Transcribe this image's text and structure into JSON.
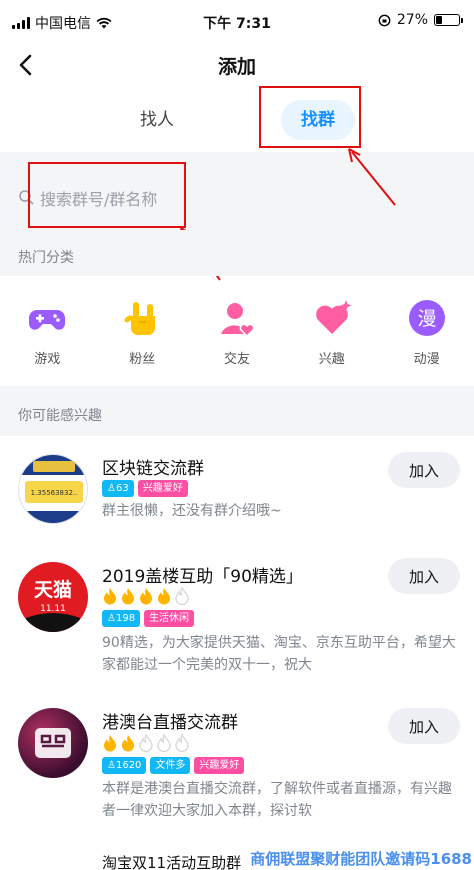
{
  "status_bar": {
    "carrier": "中国电信",
    "time": "下午 7:31",
    "battery_percent": "27%",
    "battery_level": 0.27
  },
  "nav": {
    "title": "添加"
  },
  "tabs": [
    {
      "label": "找人",
      "selected": false
    },
    {
      "label": "找群",
      "selected": true
    }
  ],
  "search": {
    "placeholder": "搜索群号/群名称"
  },
  "hot_categories": {
    "title": "热门分类",
    "items": [
      {
        "label": "游戏",
        "icon": "gamepad-icon"
      },
      {
        "label": "粉丝",
        "icon": "rock-hand-icon"
      },
      {
        "label": "交友",
        "icon": "friend-icon"
      },
      {
        "label": "兴趣",
        "icon": "heart-icon"
      },
      {
        "label": "动漫",
        "icon": "manga-icon",
        "glyph": "漫"
      }
    ]
  },
  "recommend": {
    "title": "你可能感兴趣",
    "groups": [
      {
        "name": "区块链交流群",
        "member_count": "63",
        "tags": [
          "兴趣爱好"
        ],
        "description": "群主很懒，还没有群介绍哦~",
        "join_label": "加入",
        "avatar_text": "1.35563832..",
        "fire_level": 0
      },
      {
        "name": "2019盖楼互助「90精选」",
        "member_count": "198",
        "tags": [
          "生活休闲"
        ],
        "description": "90精选，为大家提供天猫、淘宝、京东互助平台，希望大家都能过一个完美的双十一，祝大",
        "join_label": "加入",
        "avatar_text": "天猫",
        "avatar_sub": "11.11",
        "fire_level": 4
      },
      {
        "name": "港澳台直播交流群",
        "member_count": "1620",
        "tags": [
          "文件多",
          "兴趣爱好"
        ],
        "description": "本群是港澳台直播交流群，了解软件或者直播源，有兴趣者一律欢迎大家加入本群，探讨软",
        "join_label": "加入",
        "fire_level": 2
      }
    ],
    "partial_next": "淘宝双11活动互助群"
  },
  "watermark": "商佣联盟聚财能团队邀请码1688",
  "colors": {
    "accent": "#1890ff",
    "tab_bg": "#e8f5ff",
    "annotation_red": "#e01010",
    "badge_blue": "#12b7f5",
    "badge_pink": "#ff4fa3",
    "fire": "#ffb400",
    "fire_empty": "#d9d9d9",
    "category_purple": "#9b5cff",
    "category_pink": "#ff5fa2",
    "category_yellow": "#ffc400"
  }
}
